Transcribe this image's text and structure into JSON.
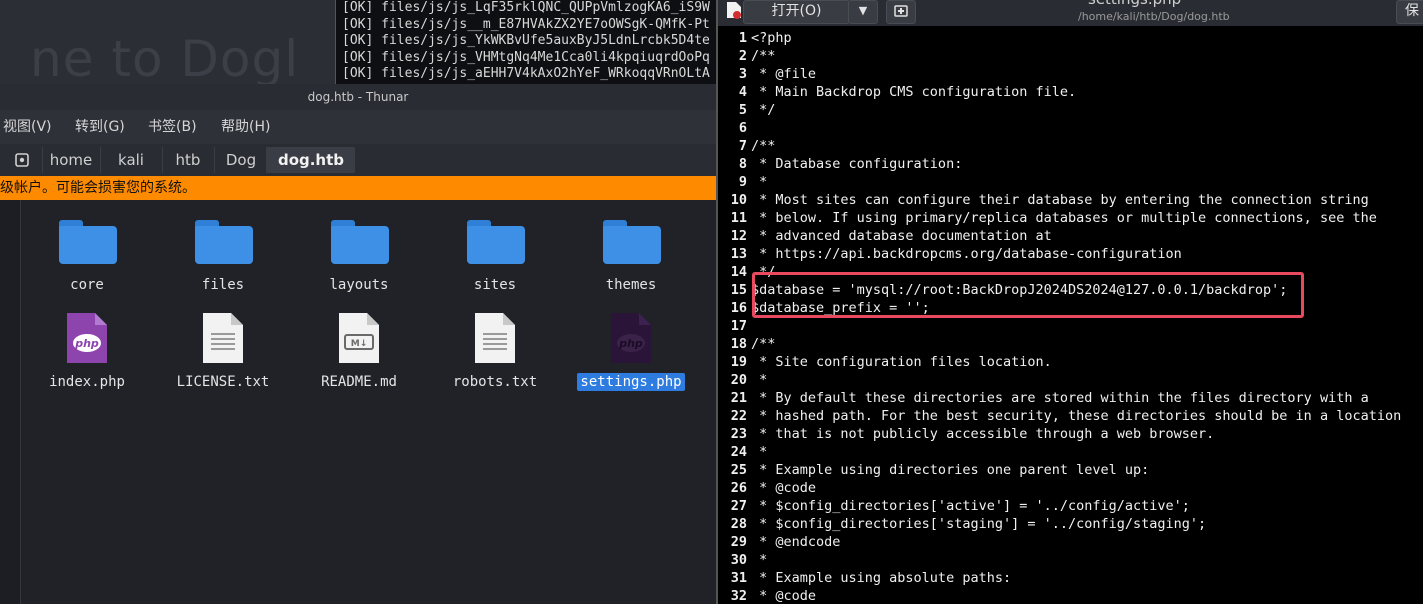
{
  "background": {
    "heading": "ne to Dogl"
  },
  "terminal": {
    "lines": [
      "[OK] files/js/js_LqF35rklQNC_QUPpVmlzogKA6_iS9W",
      "[OK] files/js/js__m_E87HVAkZX2YE7oOWSgK-QMfK-Pt",
      "[OK] files/js/js_YkWKBvUfe5auxByJ5LdnLrcbk5D4te",
      "[OK] files/js/js_VHMtgNq4Me1Cca0li4kpqiuqrdOoPq",
      "[OK] files/js/js_aEHH7V4kAxO2hYeF_WRkoqqVRnOLtA"
    ]
  },
  "thunar": {
    "title": "dog.htb - Thunar",
    "menu": [
      "视图(V)",
      "转到(G)",
      "书签(B)",
      "帮助(H)"
    ],
    "breadcrumbs": [
      "home",
      "kali",
      "htb",
      "Dog",
      "dog.htb"
    ],
    "warning": "级帐户。可能会损害您的系统。",
    "folders": [
      "core",
      "files",
      "layouts",
      "sites",
      "themes"
    ],
    "files": [
      {
        "name": "index.php",
        "badge": "php"
      },
      {
        "name": "LICENSE.txt",
        "badge": ""
      },
      {
        "name": "README.md",
        "badge": "M↓"
      },
      {
        "name": "robots.txt",
        "badge": ""
      },
      {
        "name": "settings.php",
        "badge": "php"
      }
    ],
    "colors": {
      "folder": "#3e8fe6",
      "warning": "#fe8a00",
      "selection": "#2e7ce0",
      "php_badge": "#8e44ad"
    }
  },
  "editor": {
    "title": "settings.php",
    "path": "/home/kali/htb/Dog/dog.htb",
    "open_label": "打开(O)",
    "save_label": "保",
    "highlight_color": "#e8495e",
    "lines": [
      {
        "n": "1",
        "t": "<?php"
      },
      {
        "n": "2",
        "t": "/**"
      },
      {
        "n": "3",
        "t": " * @file"
      },
      {
        "n": "4",
        "t": " * Main Backdrop CMS configuration file."
      },
      {
        "n": "5",
        "t": " */"
      },
      {
        "n": "6",
        "t": ""
      },
      {
        "n": "7",
        "t": "/**"
      },
      {
        "n": "8",
        "t": " * Database configuration:"
      },
      {
        "n": "9",
        "t": " *"
      },
      {
        "n": "10",
        "t": " * Most sites can configure their database by entering the connection string"
      },
      {
        "n": "11",
        "t": " * below. If using primary/replica databases or multiple connections, see the"
      },
      {
        "n": "12",
        "t": " * advanced database documentation at"
      },
      {
        "n": "13",
        "t": " * https://api.backdropcms.org/database-configuration"
      },
      {
        "n": "14",
        "t": " */"
      },
      {
        "n": "15",
        "t": "$database = 'mysql://root:BackDropJ2024DS2024@127.0.0.1/backdrop';"
      },
      {
        "n": "16",
        "t": "$database_prefix = '';"
      },
      {
        "n": "17",
        "t": ""
      },
      {
        "n": "18",
        "t": "/**"
      },
      {
        "n": "19",
        "t": " * Site configuration files location."
      },
      {
        "n": "20",
        "t": " *"
      },
      {
        "n": "21",
        "t": " * By default these directories are stored within the files directory with a"
      },
      {
        "n": "22",
        "t": " * hashed path. For the best security, these directories should be in a location"
      },
      {
        "n": "23",
        "t": " * that is not publicly accessible through a web browser."
      },
      {
        "n": "24",
        "t": " *"
      },
      {
        "n": "25",
        "t": " * Example using directories one parent level up:"
      },
      {
        "n": "26",
        "t": " * @code"
      },
      {
        "n": "27",
        "t": " * $config_directories['active'] = '../config/active';"
      },
      {
        "n": "28",
        "t": " * $config_directories['staging'] = '../config/staging';"
      },
      {
        "n": "29",
        "t": " * @endcode"
      },
      {
        "n": "30",
        "t": " *"
      },
      {
        "n": "31",
        "t": " * Example using absolute paths:"
      },
      {
        "n": "32",
        "t": " * @code"
      }
    ]
  }
}
